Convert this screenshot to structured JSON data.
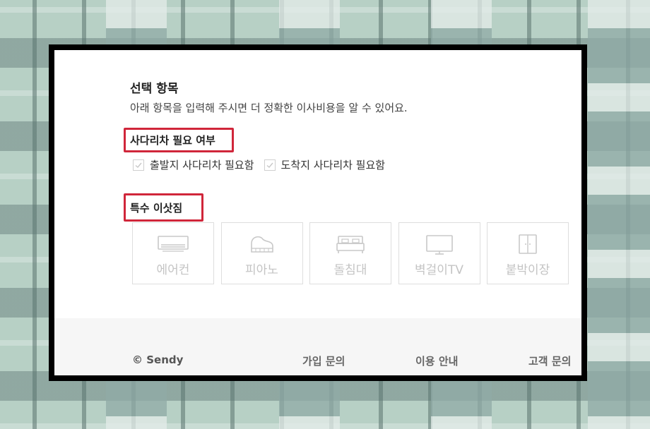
{
  "form": {
    "title": "선택 항목",
    "subtitle": "아래 항목을 입력해 주시면 더 정확한 이사비용을 알 수 있어요."
  },
  "ladder_section": {
    "heading": "사다리차 필요 여부",
    "options": [
      "출발지 사다리차 필요함",
      "도착지 사다리차 필요함"
    ]
  },
  "special_section": {
    "heading": "특수 이삿짐",
    "items": [
      {
        "label": "에어컨",
        "icon": "air-conditioner-icon"
      },
      {
        "label": "피아노",
        "icon": "piano-icon"
      },
      {
        "label": "돌침대",
        "icon": "bed-icon"
      },
      {
        "label": "벽걸이TV",
        "icon": "tv-icon"
      },
      {
        "label": "붙박이장",
        "icon": "wardrobe-icon"
      }
    ]
  },
  "footer": {
    "copyright": "© Sendy",
    "links": [
      "가입 문의",
      "이용 안내",
      "고객 문의"
    ]
  },
  "colors": {
    "highlight_border": "#d0263a",
    "disabled_text": "#c4c4c4",
    "footer_bg": "#f6f6f6"
  }
}
